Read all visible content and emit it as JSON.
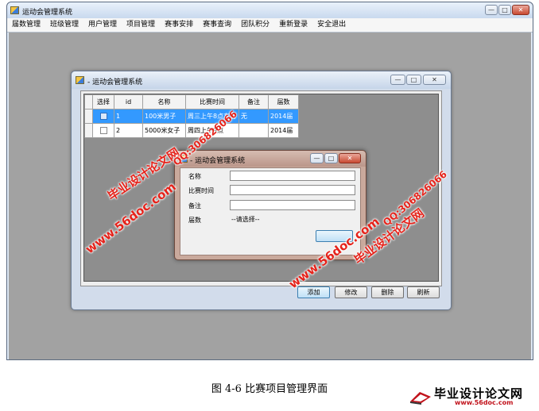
{
  "main_window": {
    "title": "运动会管理系统",
    "menu": [
      "届数管理",
      "班级管理",
      "用户管理",
      "项目管理",
      "赛事安排",
      "赛事查询",
      "团队积分",
      "重新登录",
      "安全退出"
    ]
  },
  "project_window": {
    "title": "- 运动会管理系统",
    "grid": {
      "columns": [
        "选择",
        "id",
        "名称",
        "比赛时间",
        "备注",
        "届数"
      ],
      "rows": [
        {
          "id": "1",
          "name": "100米男子",
          "time": "周三上午8点左右",
          "remark": "无",
          "session": "2014届"
        },
        {
          "id": "2",
          "name": "5000米女子",
          "time": "周四上午9点",
          "remark": "",
          "session": "2014届"
        }
      ]
    },
    "buttons": {
      "add": "添加",
      "edit": "修改",
      "delete": "删除",
      "refresh": "刷新"
    }
  },
  "dialog": {
    "title": "- 运动会管理系统",
    "labels": {
      "name": "名称",
      "time": "比赛时间",
      "remark": "备注",
      "session": "届数"
    },
    "session_placeholder": "--请选择--"
  },
  "watermarks": {
    "site": "毕业设计论文网",
    "url": "www.56doc.com",
    "qq": "QQ:306826066"
  },
  "caption": "图 4-6 比赛项目管理界面",
  "logo": {
    "name": "毕业设计论文网",
    "url": "www.56doc.com"
  },
  "window_controls": {
    "minimize": "—",
    "maximize": "□",
    "close": "✕"
  },
  "colors": {
    "watermark": "#e5231b",
    "selection": "#3399ff",
    "client_bg": "#a2a2a2"
  }
}
